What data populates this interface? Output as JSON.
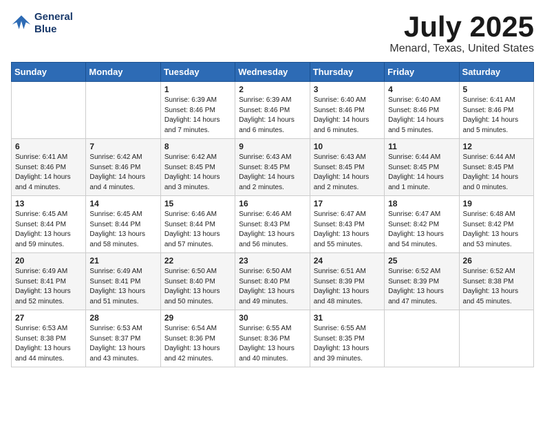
{
  "header": {
    "logo_line1": "General",
    "logo_line2": "Blue",
    "month": "July 2025",
    "location": "Menard, Texas, United States"
  },
  "weekdays": [
    "Sunday",
    "Monday",
    "Tuesday",
    "Wednesday",
    "Thursday",
    "Friday",
    "Saturday"
  ],
  "weeks": [
    [
      {
        "day": "",
        "sunrise": "",
        "sunset": "",
        "daylight": ""
      },
      {
        "day": "",
        "sunrise": "",
        "sunset": "",
        "daylight": ""
      },
      {
        "day": "1",
        "sunrise": "Sunrise: 6:39 AM",
        "sunset": "Sunset: 8:46 PM",
        "daylight": "Daylight: 14 hours and 7 minutes."
      },
      {
        "day": "2",
        "sunrise": "Sunrise: 6:39 AM",
        "sunset": "Sunset: 8:46 PM",
        "daylight": "Daylight: 14 hours and 6 minutes."
      },
      {
        "day": "3",
        "sunrise": "Sunrise: 6:40 AM",
        "sunset": "Sunset: 8:46 PM",
        "daylight": "Daylight: 14 hours and 6 minutes."
      },
      {
        "day": "4",
        "sunrise": "Sunrise: 6:40 AM",
        "sunset": "Sunset: 8:46 PM",
        "daylight": "Daylight: 14 hours and 5 minutes."
      },
      {
        "day": "5",
        "sunrise": "Sunrise: 6:41 AM",
        "sunset": "Sunset: 8:46 PM",
        "daylight": "Daylight: 14 hours and 5 minutes."
      }
    ],
    [
      {
        "day": "6",
        "sunrise": "Sunrise: 6:41 AM",
        "sunset": "Sunset: 8:46 PM",
        "daylight": "Daylight: 14 hours and 4 minutes."
      },
      {
        "day": "7",
        "sunrise": "Sunrise: 6:42 AM",
        "sunset": "Sunset: 8:46 PM",
        "daylight": "Daylight: 14 hours and 4 minutes."
      },
      {
        "day": "8",
        "sunrise": "Sunrise: 6:42 AM",
        "sunset": "Sunset: 8:45 PM",
        "daylight": "Daylight: 14 hours and 3 minutes."
      },
      {
        "day": "9",
        "sunrise": "Sunrise: 6:43 AM",
        "sunset": "Sunset: 8:45 PM",
        "daylight": "Daylight: 14 hours and 2 minutes."
      },
      {
        "day": "10",
        "sunrise": "Sunrise: 6:43 AM",
        "sunset": "Sunset: 8:45 PM",
        "daylight": "Daylight: 14 hours and 2 minutes."
      },
      {
        "day": "11",
        "sunrise": "Sunrise: 6:44 AM",
        "sunset": "Sunset: 8:45 PM",
        "daylight": "Daylight: 14 hours and 1 minute."
      },
      {
        "day": "12",
        "sunrise": "Sunrise: 6:44 AM",
        "sunset": "Sunset: 8:45 PM",
        "daylight": "Daylight: 14 hours and 0 minutes."
      }
    ],
    [
      {
        "day": "13",
        "sunrise": "Sunrise: 6:45 AM",
        "sunset": "Sunset: 8:44 PM",
        "daylight": "Daylight: 13 hours and 59 minutes."
      },
      {
        "day": "14",
        "sunrise": "Sunrise: 6:45 AM",
        "sunset": "Sunset: 8:44 PM",
        "daylight": "Daylight: 13 hours and 58 minutes."
      },
      {
        "day": "15",
        "sunrise": "Sunrise: 6:46 AM",
        "sunset": "Sunset: 8:44 PM",
        "daylight": "Daylight: 13 hours and 57 minutes."
      },
      {
        "day": "16",
        "sunrise": "Sunrise: 6:46 AM",
        "sunset": "Sunset: 8:43 PM",
        "daylight": "Daylight: 13 hours and 56 minutes."
      },
      {
        "day": "17",
        "sunrise": "Sunrise: 6:47 AM",
        "sunset": "Sunset: 8:43 PM",
        "daylight": "Daylight: 13 hours and 55 minutes."
      },
      {
        "day": "18",
        "sunrise": "Sunrise: 6:47 AM",
        "sunset": "Sunset: 8:42 PM",
        "daylight": "Daylight: 13 hours and 54 minutes."
      },
      {
        "day": "19",
        "sunrise": "Sunrise: 6:48 AM",
        "sunset": "Sunset: 8:42 PM",
        "daylight": "Daylight: 13 hours and 53 minutes."
      }
    ],
    [
      {
        "day": "20",
        "sunrise": "Sunrise: 6:49 AM",
        "sunset": "Sunset: 8:41 PM",
        "daylight": "Daylight: 13 hours and 52 minutes."
      },
      {
        "day": "21",
        "sunrise": "Sunrise: 6:49 AM",
        "sunset": "Sunset: 8:41 PM",
        "daylight": "Daylight: 13 hours and 51 minutes."
      },
      {
        "day": "22",
        "sunrise": "Sunrise: 6:50 AM",
        "sunset": "Sunset: 8:40 PM",
        "daylight": "Daylight: 13 hours and 50 minutes."
      },
      {
        "day": "23",
        "sunrise": "Sunrise: 6:50 AM",
        "sunset": "Sunset: 8:40 PM",
        "daylight": "Daylight: 13 hours and 49 minutes."
      },
      {
        "day": "24",
        "sunrise": "Sunrise: 6:51 AM",
        "sunset": "Sunset: 8:39 PM",
        "daylight": "Daylight: 13 hours and 48 minutes."
      },
      {
        "day": "25",
        "sunrise": "Sunrise: 6:52 AM",
        "sunset": "Sunset: 8:39 PM",
        "daylight": "Daylight: 13 hours and 47 minutes."
      },
      {
        "day": "26",
        "sunrise": "Sunrise: 6:52 AM",
        "sunset": "Sunset: 8:38 PM",
        "daylight": "Daylight: 13 hours and 45 minutes."
      }
    ],
    [
      {
        "day": "27",
        "sunrise": "Sunrise: 6:53 AM",
        "sunset": "Sunset: 8:38 PM",
        "daylight": "Daylight: 13 hours and 44 minutes."
      },
      {
        "day": "28",
        "sunrise": "Sunrise: 6:53 AM",
        "sunset": "Sunset: 8:37 PM",
        "daylight": "Daylight: 13 hours and 43 minutes."
      },
      {
        "day": "29",
        "sunrise": "Sunrise: 6:54 AM",
        "sunset": "Sunset: 8:36 PM",
        "daylight": "Daylight: 13 hours and 42 minutes."
      },
      {
        "day": "30",
        "sunrise": "Sunrise: 6:55 AM",
        "sunset": "Sunset: 8:36 PM",
        "daylight": "Daylight: 13 hours and 40 minutes."
      },
      {
        "day": "31",
        "sunrise": "Sunrise: 6:55 AM",
        "sunset": "Sunset: 8:35 PM",
        "daylight": "Daylight: 13 hours and 39 minutes."
      },
      {
        "day": "",
        "sunrise": "",
        "sunset": "",
        "daylight": ""
      },
      {
        "day": "",
        "sunrise": "",
        "sunset": "",
        "daylight": ""
      }
    ]
  ]
}
